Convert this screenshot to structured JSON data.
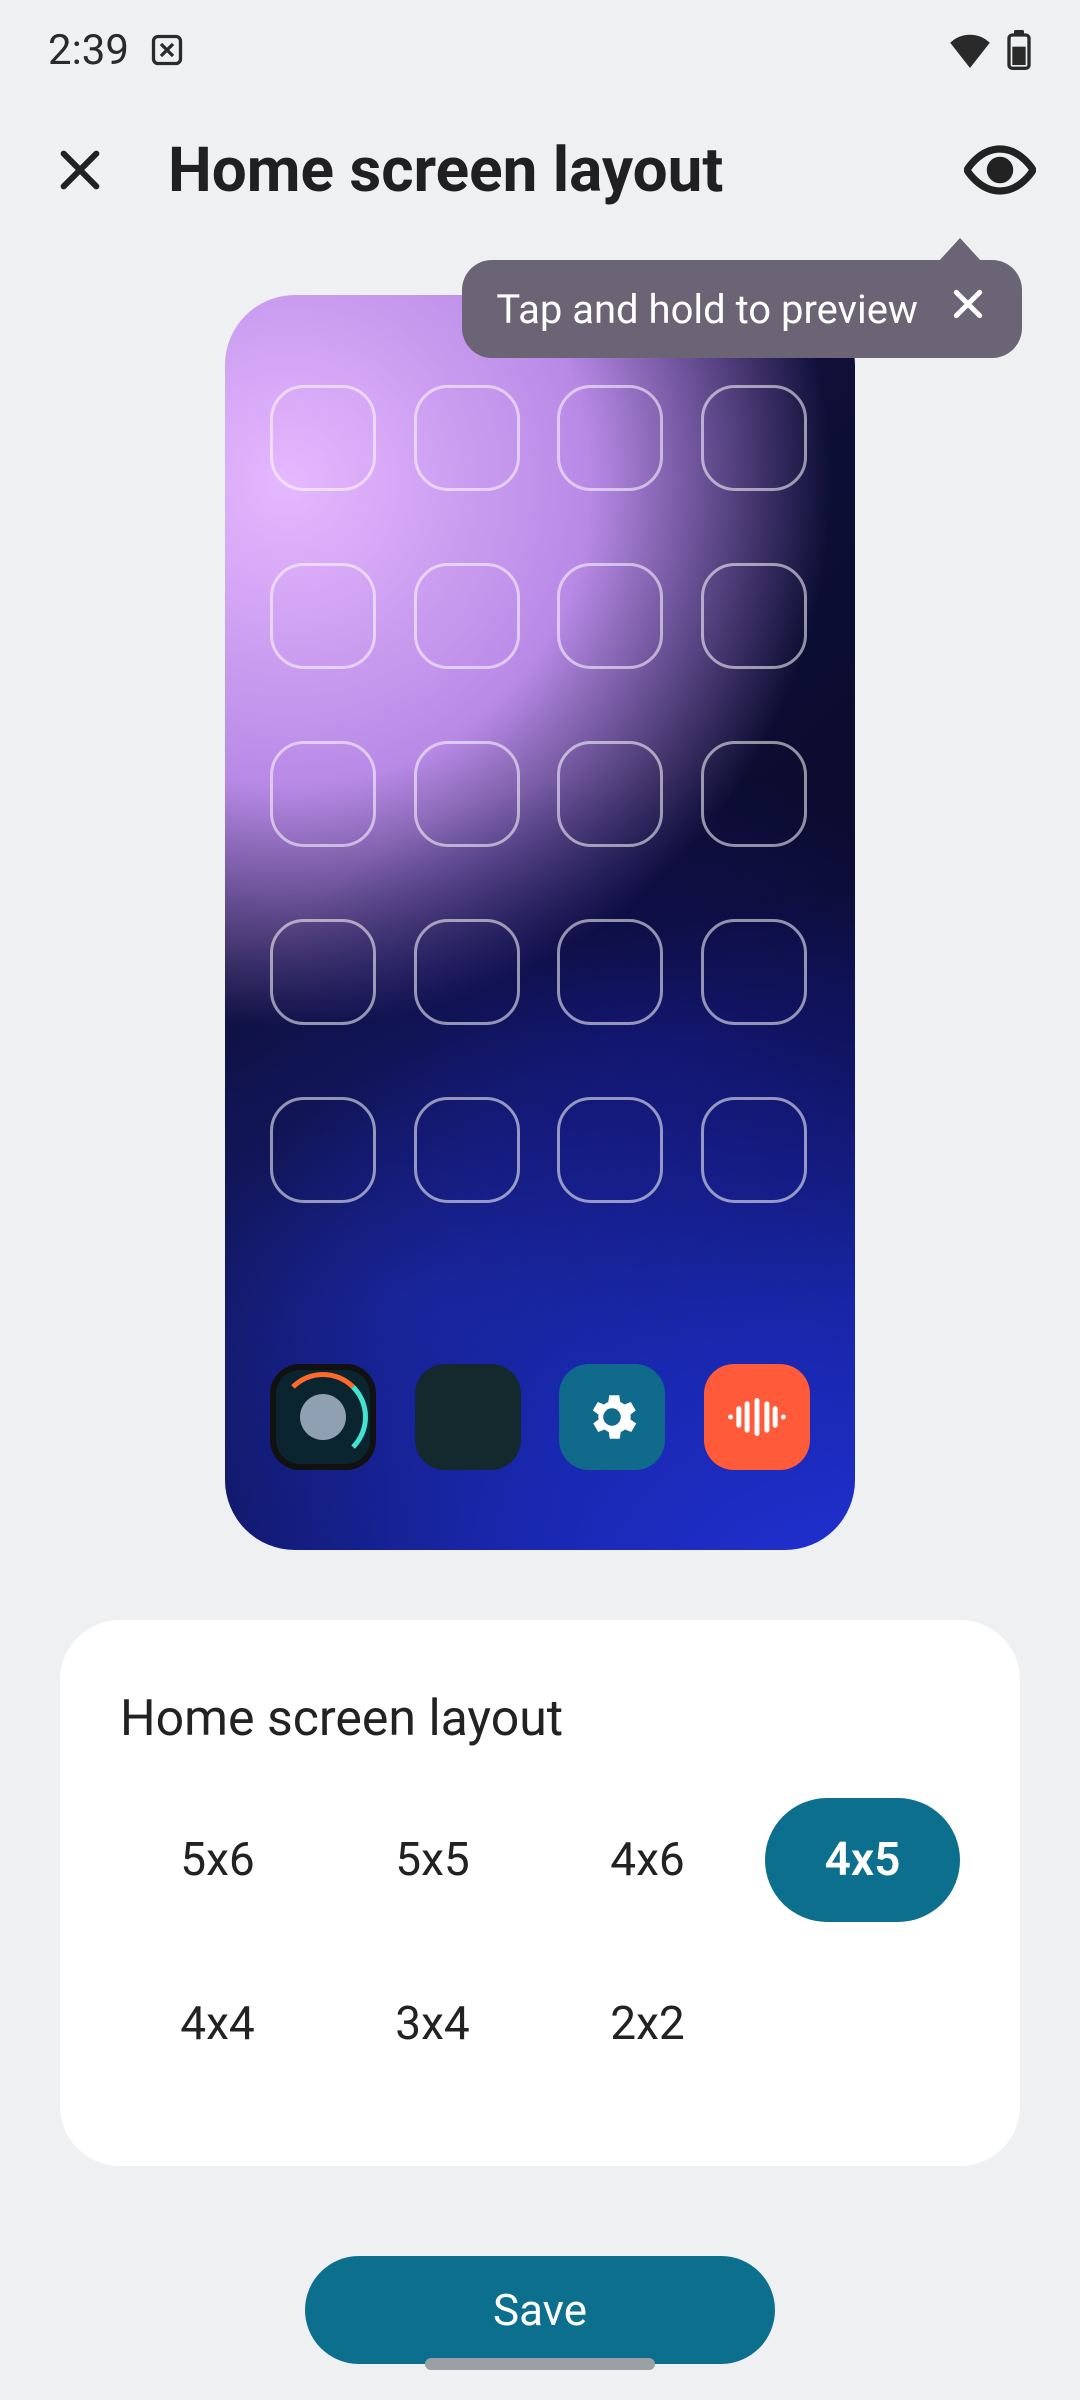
{
  "status": {
    "time": "2:39"
  },
  "header": {
    "title": "Home screen layout"
  },
  "tooltip": {
    "text": "Tap and hold to preview"
  },
  "preview": {
    "grid": {
      "cols": 4,
      "rows": 5
    },
    "dock": [
      "moto",
      "apps",
      "settings",
      "recorder"
    ]
  },
  "card": {
    "title": "Home screen layout",
    "options": [
      "5x6",
      "5x5",
      "4x6",
      "4x5",
      "4x4",
      "3x4",
      "2x2"
    ],
    "selected": "4x5"
  },
  "actions": {
    "save": "Save"
  },
  "colors": {
    "accent": "#0c6f8e",
    "tooltip": "#6b6474",
    "bg": "#eef0f1"
  }
}
